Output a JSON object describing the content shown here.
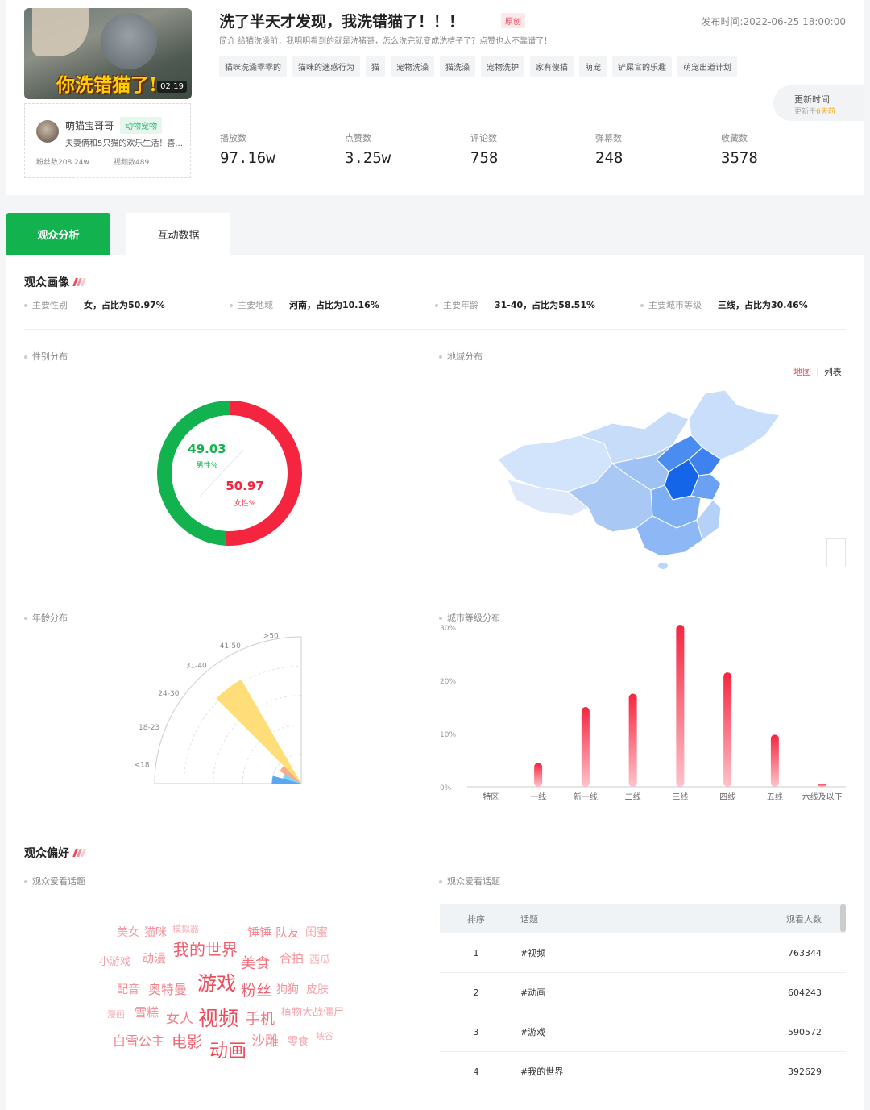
{
  "video": {
    "thumbnail_caption": "你洗错猫了!",
    "duration": "02:19",
    "title": "洗了半天才发现，我洗错猫了！！！",
    "original_badge": "原创",
    "publish_time": "发布时间:2022-06-25 18:00:00",
    "intro": "简介 给猫洗澡前，我明明看到的就是洗猪哥，怎么洗完就变成洗桔子了？点赞也太不靠谱了！",
    "tags": [
      "猫咪洗澡乖乖的",
      "猫咪的迷惑行为",
      "猫",
      "宠物洗澡",
      "猫洗澡",
      "宠物洗护",
      "家有傻猫",
      "萌宠",
      "铲屎官的乐趣",
      "萌宠出道计划"
    ],
    "update": {
      "label": "更新时间",
      "prefix": "更新于",
      "ago": "6天前"
    },
    "metrics": [
      {
        "label": "播放数",
        "value": "97.16w"
      },
      {
        "label": "点赞数",
        "value": "3.25w"
      },
      {
        "label": "评论数",
        "value": "758"
      },
      {
        "label": "弹幕数",
        "value": "248"
      },
      {
        "label": "收藏数",
        "value": "3578"
      }
    ]
  },
  "author": {
    "name": "萌猫宝哥哥",
    "category": "动物宠物",
    "desc": "夫妻俩和5只猫的欢乐生活！喜...",
    "fans": "粉丝数208.24w",
    "videos": "视频数489"
  },
  "tabs": {
    "audience": "观众分析",
    "interaction": "互动数据"
  },
  "portrait": {
    "title": "观众画像",
    "summary": [
      {
        "k": "主要性别",
        "v": "女，占比为50.97%"
      },
      {
        "k": "主要地域",
        "v": "河南，占比为10.16%"
      },
      {
        "k": "主要年龄",
        "v": "31-40，占比为58.51%"
      },
      {
        "k": "主要城市等级",
        "v": "三线，占比为30.46%"
      }
    ],
    "gender_title": "性别分布",
    "region_title": "地域分布",
    "age_title": "年龄分布",
    "city_title": "城市等级分布",
    "map_toggle": {
      "map": "地图",
      "list": "列表"
    }
  },
  "colors": {
    "green": "#12b24f",
    "red": "#f5253f",
    "accent": "#f04a5a"
  },
  "chart_data": [
    {
      "type": "pie",
      "categories": [
        "男性%",
        "女性%"
      ],
      "values": [
        49.03,
        50.97
      ],
      "labels": [
        "49.03",
        "50.97"
      ]
    },
    {
      "type": "bar",
      "categories": [
        "<18",
        "18-23",
        "24-30",
        "31-40",
        "41-50",
        ">50"
      ],
      "values": [
        3.5,
        1.5,
        2.5,
        58.51,
        0,
        0
      ],
      "note_type": "polar"
    },
    {
      "type": "bar",
      "categories": [
        "特区",
        "一线",
        "新一线",
        "二线",
        "三线",
        "四线",
        "五线",
        "六线及以下"
      ],
      "values": [
        0,
        4.5,
        15,
        17.5,
        30.46,
        21.5,
        9.8,
        0.6
      ],
      "ytick_labels": [
        "0%",
        "10%",
        "20%",
        "30%"
      ],
      "ylim": [
        0,
        30
      ]
    }
  ],
  "preference": {
    "title": "观众偏好",
    "topics_title": "观众爱看话题",
    "topics_title2": "观众爱看话题",
    "words": [
      {
        "t": "美女",
        "s": 14,
        "o": 0.55
      },
      {
        "t": "猫咪",
        "s": 14,
        "o": 0.6
      },
      {
        "t": "模拟器",
        "s": 11,
        "o": 0.45
      },
      {
        "t": "锤锤",
        "s": 15,
        "o": 0.65
      },
      {
        "t": "队友",
        "s": 15,
        "o": 0.65
      },
      {
        "t": "闺蜜",
        "s": 14,
        "o": 0.5
      },
      {
        "t": "我的世界",
        "s": 20,
        "o": 0.9
      },
      {
        "t": "小游戏",
        "s": 13,
        "o": 0.55
      },
      {
        "t": "动漫",
        "s": 15,
        "o": 0.6
      },
      {
        "t": "美食",
        "s": 18,
        "o": 0.8
      },
      {
        "t": "合拍",
        "s": 15,
        "o": 0.6
      },
      {
        "t": "西瓜",
        "s": 13,
        "o": 0.45
      },
      {
        "t": "游戏",
        "s": 24,
        "o": 1
      },
      {
        "t": "配音",
        "s": 14,
        "o": 0.6
      },
      {
        "t": "奥特曼",
        "s": 16,
        "o": 0.7
      },
      {
        "t": "粉丝",
        "s": 19,
        "o": 0.85
      },
      {
        "t": "狗狗",
        "s": 14,
        "o": 0.6
      },
      {
        "t": "皮肤",
        "s": 14,
        "o": 0.5
      },
      {
        "t": "漫画",
        "s": 11,
        "o": 0.45
      },
      {
        "t": "雪糕",
        "s": 15,
        "o": 0.6
      },
      {
        "t": "女人",
        "s": 17,
        "o": 0.7
      },
      {
        "t": "视频",
        "s": 25,
        "o": 1
      },
      {
        "t": "手机",
        "s": 18,
        "o": 0.75
      },
      {
        "t": "植物大战僵尸",
        "s": 13,
        "o": 0.5
      },
      {
        "t": "白雪公主",
        "s": 16,
        "o": 0.7
      },
      {
        "t": "电影",
        "s": 19,
        "o": 0.85
      },
      {
        "t": "动画",
        "s": 23,
        "o": 1
      },
      {
        "t": "沙雕",
        "s": 17,
        "o": 0.65
      },
      {
        "t": "零食",
        "s": 13,
        "o": 0.5
      },
      {
        "t": "峡谷",
        "s": 11,
        "o": 0.45
      }
    ],
    "table_headers": {
      "rank": "排序",
      "topic": "话题",
      "viewers": "观看人数"
    },
    "table": [
      {
        "rank": "1",
        "topic": "#视频",
        "viewers": "763344"
      },
      {
        "rank": "2",
        "topic": "#动画",
        "viewers": "604243"
      },
      {
        "rank": "3",
        "topic": "#游戏",
        "viewers": "590572"
      },
      {
        "rank": "4",
        "topic": "#我的世界",
        "viewers": "392629"
      }
    ]
  }
}
